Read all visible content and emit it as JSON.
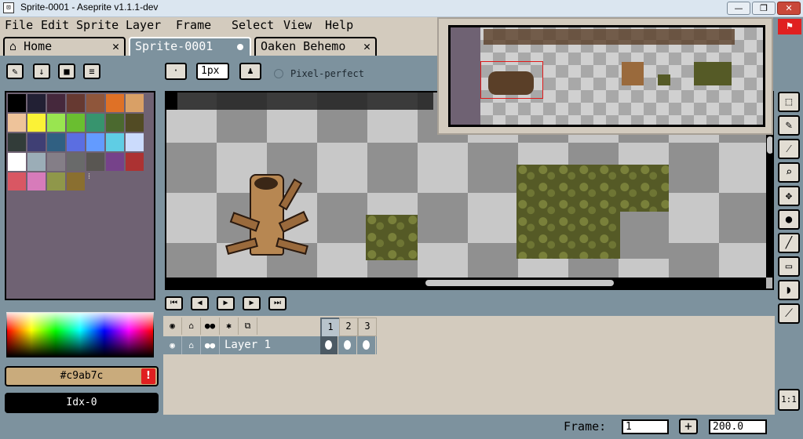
{
  "window": {
    "title": "Sprite-0001 - Aseprite v1.1.1-dev",
    "minimize_icon": "minimize-icon",
    "maximize_icon": "maximize-icon",
    "close_icon": "close-icon"
  },
  "menu": [
    "File",
    "Edit",
    "Sprite",
    "Layer",
    "Frame",
    "Select",
    "View",
    "Help"
  ],
  "tabs": {
    "home": "Home",
    "sprite": "Sprite-0001",
    "oaken": "Oaken Behemo"
  },
  "toolbar": {
    "brush_size": "1px",
    "pixel_perfect": "Pixel-perfect"
  },
  "palette": {
    "colors": [
      "#000000",
      "#222034",
      "#45283c",
      "#663931",
      "#8f563b",
      "#df7126",
      "#d9a066",
      "#eec39a",
      "#fbf236",
      "#99e550",
      "#6abe30",
      "#37946e",
      "#4b692f",
      "#524b24",
      "#323c39",
      "#3f3f74",
      "#306082",
      "#5b6ee1",
      "#639bff",
      "#5fcde4",
      "#cbdbfc",
      "#ffffff",
      "#9badb7",
      "#847e87",
      "#696a6a",
      "#595652",
      "#76428a",
      "#ac3232",
      "#d95763",
      "#d77bba",
      "#8f974a",
      "#8a6f30"
    ],
    "fg_hex": "#c9ab7c",
    "bg_index": "Idx-0"
  },
  "timeline": {
    "layer_name": "Layer 1",
    "frames": [
      "1",
      "2",
      "3"
    ]
  },
  "status": {
    "frame_label": "Frame:",
    "frame_value": "1",
    "add_label": "+",
    "zoom": "200.0",
    "ratio": "1:1"
  }
}
